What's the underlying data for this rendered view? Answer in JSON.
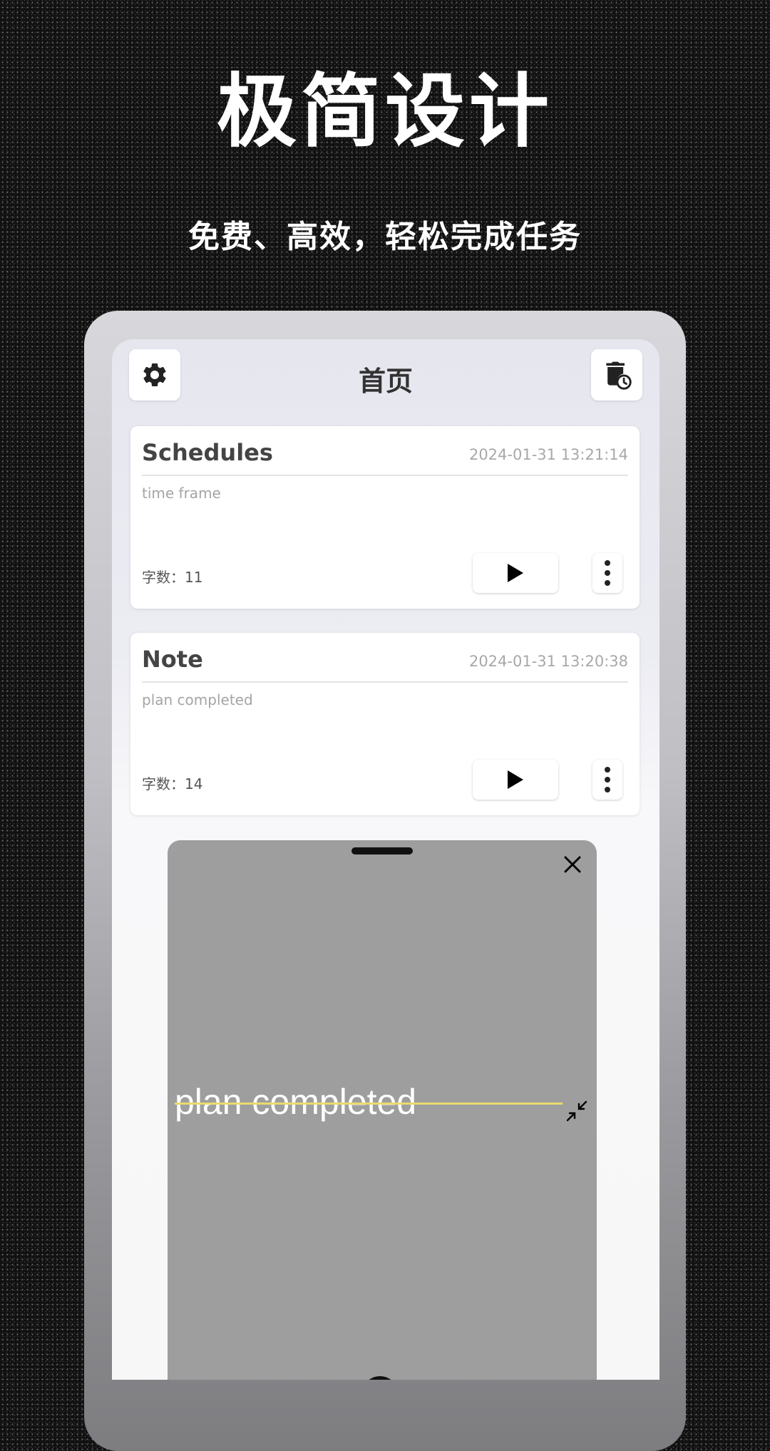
{
  "hero": {
    "title": "极简设计",
    "subtitle": "免费、高效，轻松完成任务"
  },
  "screen": {
    "title": "首页",
    "settings_icon": "gear-icon",
    "history_icon": "trash-clock-icon"
  },
  "cards": [
    {
      "title": "Schedules",
      "timestamp": "2024-01-31 13:21:14",
      "body": "time frame",
      "count": "字数：11"
    },
    {
      "title": "Note",
      "timestamp": "2024-01-31 13:20:38",
      "body": "plan completed",
      "count": "字数：14"
    }
  ],
  "overlay": {
    "text": "plan completed",
    "close_icon": "close-icon",
    "shrink_icon": "minimize-arrows-icon",
    "strike_color": "#e8dc6c"
  }
}
